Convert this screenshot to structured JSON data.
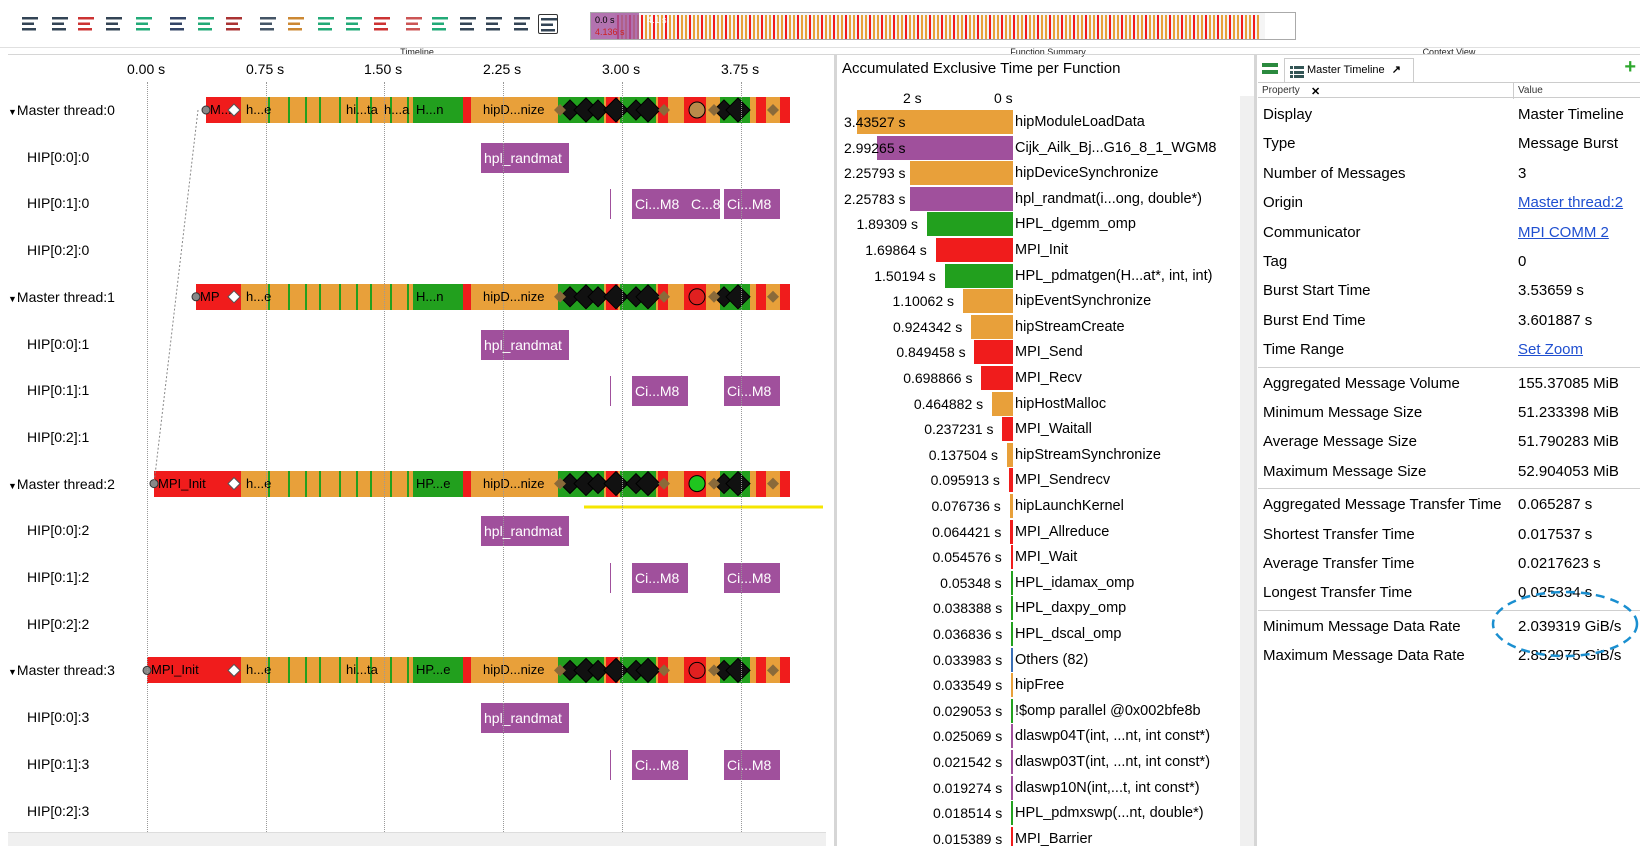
{
  "panels": {
    "timeline": "Timeline",
    "function_summary": "Function Summary",
    "context_view": "Context View"
  },
  "toolbar": {
    "icons": [
      "process-timeline-icon",
      "function-timeline-icon",
      "counter-timeline-icon",
      "performance-radar-icon",
      "chart-icon",
      "call-tree-icon",
      "message-summary-icon",
      "communication-matrix-icon",
      "zoom-icon",
      "home-icon",
      "message-icon",
      "filter-icon",
      "sort-icon",
      "grid-icon",
      "hierarchy-icon",
      "tree-icon",
      "list-icon",
      "pin-icon",
      "notes-icon"
    ]
  },
  "overview": {
    "start": "0.0 s",
    "mark": "4.136 s",
    "end": "4.1 s"
  },
  "timeline": {
    "axis": [
      "0.00 s",
      "0.75 s",
      "1.50 s",
      "2.25 s",
      "3.00 s",
      "3.75 s"
    ],
    "rows": [
      {
        "label": "Master thread:0",
        "type": "master"
      },
      {
        "label": "HIP[0:0]:0"
      },
      {
        "label": "HIP[0:1]:0"
      },
      {
        "label": "HIP[0:2]:0"
      },
      {
        "label": "Master thread:1",
        "type": "master"
      },
      {
        "label": "HIP[0:0]:1"
      },
      {
        "label": "HIP[0:1]:1"
      },
      {
        "label": "HIP[0:2]:1"
      },
      {
        "label": "Master thread:2",
        "type": "master"
      },
      {
        "label": "HIP[0:0]:2"
      },
      {
        "label": "HIP[0:1]:2"
      },
      {
        "label": "HIP[0:2]:2"
      },
      {
        "label": "Master thread:3",
        "type": "master"
      },
      {
        "label": "HIP[0:0]:3"
      },
      {
        "label": "HIP[0:1]:3"
      },
      {
        "label": "HIP[0:2]:3"
      }
    ],
    "m0": {
      "a": "M...",
      "b": "h...e",
      "c": "hi...ta",
      "d": "h...a",
      "e": "H...n",
      "f": "hipD...nize"
    },
    "m1": {
      "a": "MP",
      "b": "h...e",
      "e": "H...n",
      "f": "hipD...nize"
    },
    "m2": {
      "a": "MPI_Init",
      "b": "h...e",
      "e": "HP...e",
      "f": "hipD...nize"
    },
    "m3": {
      "a": "MPI_Init",
      "b": "h...e",
      "c": "hi...ta",
      "e": "HP...e",
      "f": "hipD...nize"
    },
    "kernels": {
      "randmat": "hpl_randmat",
      "cim8": "Ci...M8",
      "c8": "C...8"
    }
  },
  "function_summary": {
    "title": "Accumulated Exclusive Time per Function",
    "axis": [
      "2 s",
      "0 s"
    ],
    "rows": [
      {
        "value": "3.43527 s",
        "name": "hipModuleLoadData",
        "secs": 3.43527,
        "color": "#e8a03a"
      },
      {
        "value": "2.99265 s",
        "name": "Cijk_Ailk_Bj...G16_8_1_WGM8",
        "secs": 2.99265,
        "color": "#a0509c"
      },
      {
        "value": "2.25793 s",
        "name": "hipDeviceSynchronize",
        "secs": 2.25793,
        "color": "#e8a03a"
      },
      {
        "value": "2.25783 s",
        "name": "hpl_randmat(i...ong, double*)",
        "secs": 2.25783,
        "color": "#a0509c"
      },
      {
        "value": "1.89309 s",
        "name": "HPL_dgemm_omp",
        "secs": 1.89309,
        "color": "#22a01e"
      },
      {
        "value": "1.69864 s",
        "name": "MPI_Init",
        "secs": 1.69864,
        "color": "#f01c1c"
      },
      {
        "value": "1.50194 s",
        "name": "HPL_pdmatgen(H...at*, int, int)",
        "secs": 1.50194,
        "color": "#22a01e"
      },
      {
        "value": "1.10062 s",
        "name": "hipEventSynchronize",
        "secs": 1.10062,
        "color": "#e8a03a"
      },
      {
        "value": "0.924342 s",
        "name": "hipStreamCreate",
        "secs": 0.924342,
        "color": "#e8a03a"
      },
      {
        "value": "0.849458 s",
        "name": "MPI_Send",
        "secs": 0.849458,
        "color": "#f01c1c"
      },
      {
        "value": "0.698866 s",
        "name": "MPI_Recv",
        "secs": 0.698866,
        "color": "#f01c1c"
      },
      {
        "value": "0.464882 s",
        "name": "hipHostMalloc",
        "secs": 0.464882,
        "color": "#e8a03a"
      },
      {
        "value": "0.237231 s",
        "name": "MPI_Waitall",
        "secs": 0.237231,
        "color": "#f01c1c"
      },
      {
        "value": "0.137504 s",
        "name": "hipStreamSynchronize",
        "secs": 0.137504,
        "color": "#e8a03a"
      },
      {
        "value": "0.095913 s",
        "name": "MPI_Sendrecv",
        "secs": 0.095913,
        "color": "#f01c1c"
      },
      {
        "value": "0.076736 s",
        "name": "hipLaunchKernel",
        "secs": 0.076736,
        "color": "#e8a03a"
      },
      {
        "value": "0.064421 s",
        "name": "MPI_Allreduce",
        "secs": 0.064421,
        "color": "#f01c1c"
      },
      {
        "value": "0.054576 s",
        "name": "MPI_Wait",
        "secs": 0.054576,
        "color": "#f01c1c"
      },
      {
        "value": "0.05348 s",
        "name": "HPL_idamax_omp",
        "secs": 0.05348,
        "color": "#22a01e"
      },
      {
        "value": "0.038388 s",
        "name": "HPL_daxpy_omp",
        "secs": 0.038388,
        "color": "#22a01e"
      },
      {
        "value": "0.036836 s",
        "name": "HPL_dscal_omp",
        "secs": 0.036836,
        "color": "#22a01e"
      },
      {
        "value": "0.033983 s",
        "name": "Others (82)",
        "secs": 0.033983,
        "color": "#3b6fb5"
      },
      {
        "value": "0.033549 s",
        "name": "hipFree",
        "secs": 0.033549,
        "color": "#e8a03a"
      },
      {
        "value": "0.029053 s",
        "name": "!$omp parallel @0x002bfe8b",
        "secs": 0.029053,
        "color": "#22a01e"
      },
      {
        "value": "0.025069 s",
        "name": "dlaswp04T(int, ...nt, int const*)",
        "secs": 0.025069,
        "color": "#a0509c"
      },
      {
        "value": "0.021542 s",
        "name": "dlaswp03T(int, ...nt, int const*)",
        "secs": 0.021542,
        "color": "#a0509c"
      },
      {
        "value": "0.019274 s",
        "name": "dlaswp10N(int,...t, int const*)",
        "secs": 0.019274,
        "color": "#a0509c"
      },
      {
        "value": "0.018514 s",
        "name": "HPL_pdmxswp(...nt, double*)",
        "secs": 0.018514,
        "color": "#22a01e"
      },
      {
        "value": "0.015389 s",
        "name": "MPI_Barrier",
        "secs": 0.015389,
        "color": "#f01c1c"
      }
    ]
  },
  "context": {
    "tab_label": "Master Timeline",
    "tab_pin": "↗",
    "tab_close": "✕",
    "add": "+",
    "header": {
      "property": "Property",
      "value": "Value"
    },
    "rows": [
      {
        "key": "Display",
        "value": "Master Timeline"
      },
      {
        "key": "Type",
        "value": "Message Burst"
      },
      {
        "key": "Number of Messages",
        "value": "3"
      },
      {
        "key": "Origin",
        "value": "Master thread:2",
        "link": true
      },
      {
        "key": "Communicator",
        "value": "MPI COMM 2",
        "link": true
      },
      {
        "key": "Tag",
        "value": "0"
      },
      {
        "key": "Burst Start Time",
        "value": "3.53659 s"
      },
      {
        "key": "Burst End Time",
        "value": "3.601887 s"
      },
      {
        "key": "Time Range",
        "value": "Set Zoom",
        "link": true
      },
      {
        "key": "Aggregated Message Volume",
        "value": "155.37085 MiB"
      },
      {
        "key": "Minimum Message Size",
        "value": "51.233398 MiB"
      },
      {
        "key": "Average Message Size",
        "value": "51.790283 MiB"
      },
      {
        "key": "Maximum Message Size",
        "value": "52.904053 MiB"
      },
      {
        "key": "Aggregated Message Transfer Time",
        "value": "0.065287 s"
      },
      {
        "key": "Shortest Transfer Time",
        "value": "0.017537 s"
      },
      {
        "key": "Average Transfer Time",
        "value": "0.0217623 s"
      },
      {
        "key": "Longest Transfer Time",
        "value": "0.025334 s"
      },
      {
        "key": "Minimum Message Data Rate",
        "value": "2.039319 GiB/s"
      },
      {
        "key": "Maximum Message Data Rate",
        "value": "2.852975 GiB/s"
      }
    ]
  },
  "colors": {
    "orange": "#e8a03a",
    "green": "#22a01e",
    "red": "#f01c1c",
    "purple": "#a0509c",
    "link": "#1f4fd0",
    "highlight": "#1a8fd0",
    "marker_line": "#f5e600"
  }
}
